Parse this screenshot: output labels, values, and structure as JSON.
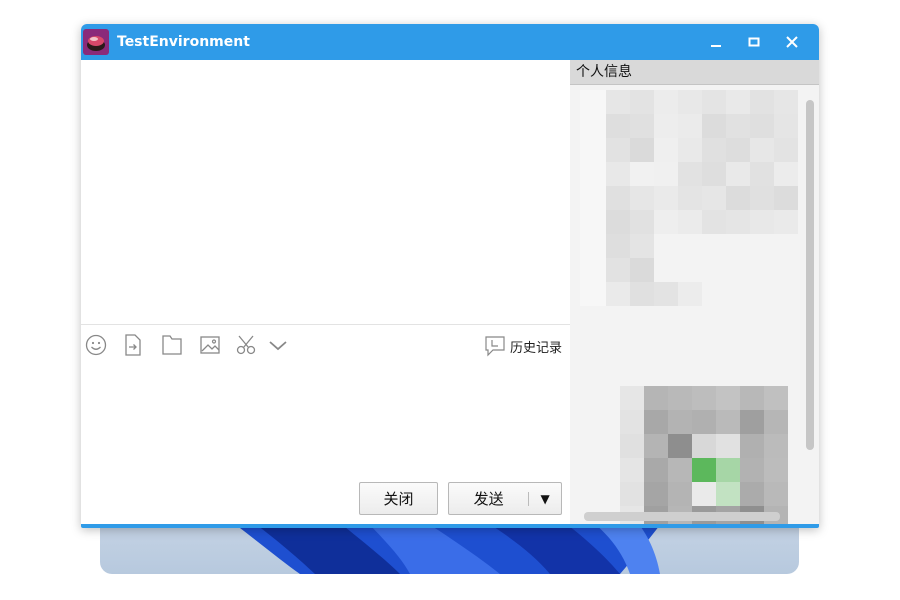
{
  "window": {
    "title": "TestEnvironment",
    "icon": "app-logo-icon",
    "controls": [
      "minimize-icon",
      "maximize-icon",
      "close-icon"
    ]
  },
  "toolbar": {
    "icons": [
      "emoji-icon",
      "send-file-icon",
      "folder-icon",
      "image-icon",
      "scissors-icon",
      "chevron-down-icon"
    ],
    "history_label": "历史记录"
  },
  "buttons": {
    "close_label": "关闭",
    "send_label": "发送",
    "send_menu": "▼"
  },
  "side_panel": {
    "header": "个人信息"
  },
  "colors": {
    "titlebar": "#2f9be8",
    "panel": "#f3f3f3",
    "panel_header": "#d9d9d9"
  }
}
